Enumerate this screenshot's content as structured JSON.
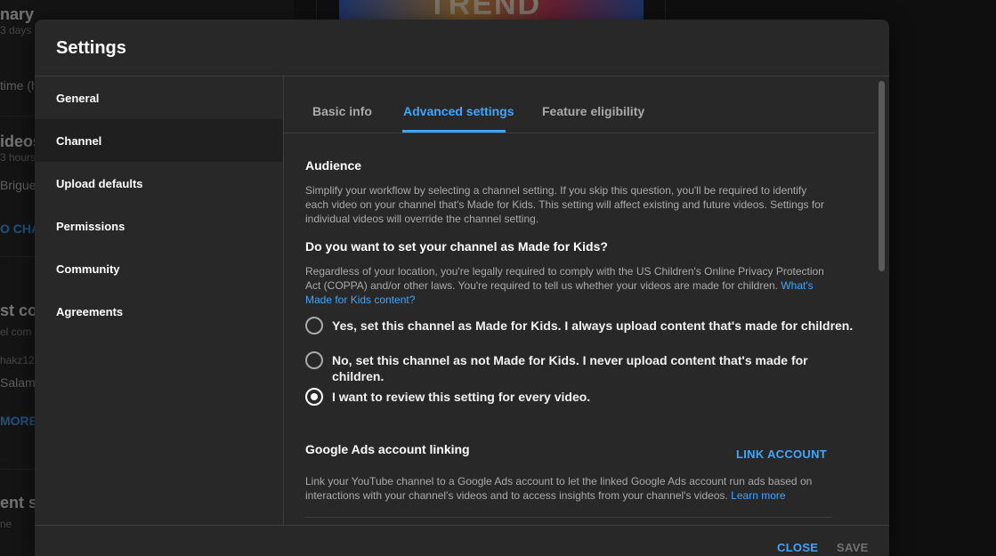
{
  "background": {
    "thumbnail_text": "TREND",
    "left_fragments": [
      {
        "text": "nary",
        "cls": "big"
      },
      {
        "text": "3 days",
        "cls": "small"
      },
      {
        "text": "time (h",
        "cls": ""
      },
      {
        "text": "ideos",
        "cls": "big"
      },
      {
        "text": "3 hours",
        "cls": "small"
      },
      {
        "text": "Briguela",
        "cls": ""
      },
      {
        "text": "O CHAN",
        "cls": "link"
      },
      {
        "text": "st com",
        "cls": "big"
      },
      {
        "text": "el com",
        "cls": "small"
      },
      {
        "text": "hakz12",
        "cls": "small"
      },
      {
        "text": "Salama",
        "cls": ""
      },
      {
        "text": "MORE",
        "cls": "link"
      },
      {
        "text": "ent su",
        "cls": "big"
      },
      {
        "text": "ne",
        "cls": "small"
      }
    ]
  },
  "dialog": {
    "title": "Settings",
    "nav": [
      {
        "label": "General"
      },
      {
        "label": "Channel"
      },
      {
        "label": "Upload defaults"
      },
      {
        "label": "Permissions"
      },
      {
        "label": "Community"
      },
      {
        "label": "Agreements"
      }
    ],
    "active_nav": "Channel",
    "tabs": [
      {
        "label": "Basic info"
      },
      {
        "label": "Advanced settings"
      },
      {
        "label": "Feature eligibility"
      }
    ],
    "active_tab": "Advanced settings",
    "audience": {
      "title": "Audience",
      "description": "Simplify your workflow by selecting a channel setting. If you skip this question, you'll be required to identify each video on your channel that's Made for Kids. This setting will affect existing and future videos. Settings for individual videos will override the channel setting.",
      "question": "Do you want to set your channel as Made for Kids?",
      "legal_text": "Regardless of your location, you're legally required to comply with the US Children's Online Privacy Protection Act (COPPA) and/or other laws. You're required to tell us whether your videos are made for children.",
      "legal_link": "What's Made for Kids content?",
      "options": [
        {
          "label": "Yes, set this channel as Made for Kids. I always upload content that's made for children.",
          "checked": false
        },
        {
          "label": "No, set this channel as not Made for Kids. I never upload content that's made for children.",
          "checked": false
        },
        {
          "label": "I want to review this setting for every video.",
          "checked": true
        }
      ]
    },
    "ads": {
      "title": "Google Ads account linking",
      "link_button": "LINK ACCOUNT",
      "description": "Link your YouTube channel to a Google Ads account to let the linked Google Ads account run ads based on interactions with your channel's videos and to access insights from your channel's videos.",
      "learn_more": "Learn more"
    },
    "footer": {
      "close": "CLOSE",
      "save": "SAVE"
    }
  },
  "colors": {
    "accent": "#3ea6ff",
    "dialog_bg": "#282828",
    "active_nav_bg": "#1f1f1f"
  }
}
